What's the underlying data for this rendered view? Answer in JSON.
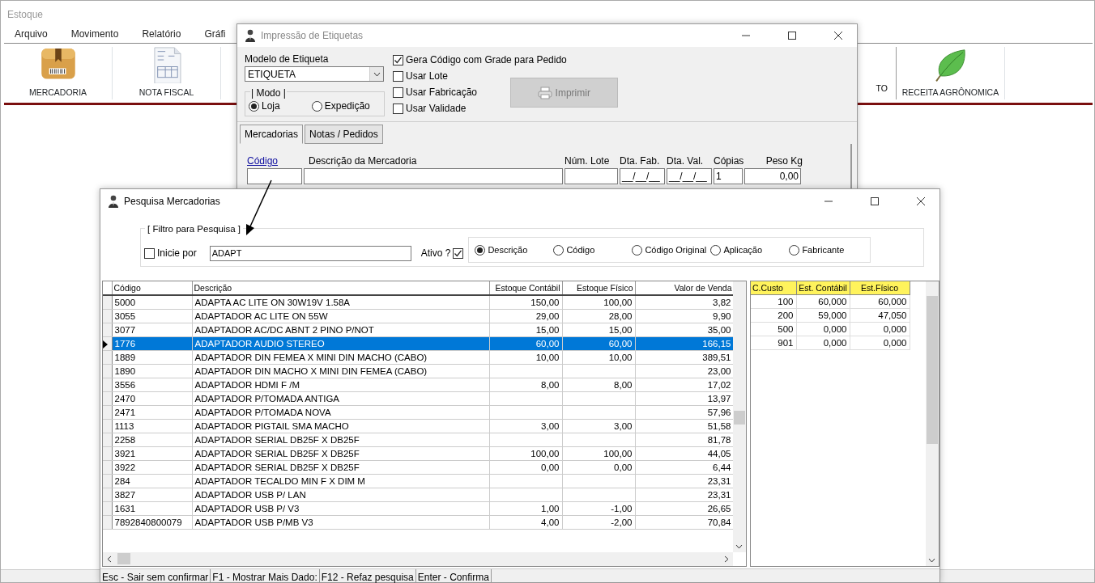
{
  "main_window": {
    "title": "Estoque",
    "menu": [
      {
        "label": "Arquivo"
      },
      {
        "label": "Movimento"
      },
      {
        "label": "Relatório"
      },
      {
        "label": "Gráfi"
      }
    ],
    "toolbar": [
      {
        "label": "MERCADORIA",
        "kind": "box"
      },
      {
        "label": "NOTA FISCAL",
        "kind": "document"
      },
      {
        "label": "TO",
        "kind": "partial"
      },
      {
        "label": "RECEITA AGRÔNOMICA",
        "kind": "leaf"
      }
    ]
  },
  "label_dialog": {
    "title": "Impressão de Etiquetas",
    "model_label": "Modelo de Etiqueta",
    "model_value": "ETIQUETA",
    "mode_label": "| Modo |",
    "modes": [
      {
        "label": "Loja",
        "selected": true
      },
      {
        "label": "Expedição",
        "selected": false
      }
    ],
    "options": [
      {
        "label": "Gera Código com Grade para Pedido",
        "checked": true
      },
      {
        "label": "Usar Lote",
        "checked": false
      },
      {
        "label": "Usar Fabricação",
        "checked": false
      },
      {
        "label": "Usar Validade",
        "checked": false
      }
    ],
    "print_button": {
      "label": "Imprimir",
      "disabled": true
    },
    "tabs": [
      {
        "label": "Mercadorias",
        "selected": true
      },
      {
        "label": "Notas / Pedidos",
        "selected": false
      }
    ],
    "fields": [
      {
        "label": "Código",
        "kind": "link"
      },
      {
        "label": "Descrição da Mercadoria",
        "kind": "label"
      },
      {
        "label": "Núm. Lote",
        "kind": "label"
      },
      {
        "label": "Dta. Fab.",
        "kind": "label",
        "value": "__/__/__"
      },
      {
        "label": "Dta. Val.",
        "kind": "label",
        "value": "__/__/__"
      },
      {
        "label": "Cópias",
        "kind": "label",
        "value": "1"
      },
      {
        "label": "Peso Kg",
        "kind": "label",
        "value": "0,00"
      }
    ]
  },
  "search_dialog": {
    "title": "Pesquisa Mercadorias",
    "filter_title": "[ Filtro para Pesquisa ]",
    "starts_with": {
      "label": "Inicie por",
      "checked": false
    },
    "search_value": "ADAPT",
    "active": {
      "label": "Ativo ?",
      "checked": true
    },
    "search_by": [
      {
        "label": "Descrição",
        "selected": true
      },
      {
        "label": "Código",
        "selected": false
      },
      {
        "label": "Código Original",
        "selected": false
      },
      {
        "label": "Aplicação",
        "selected": false
      },
      {
        "label": "Fabricante",
        "selected": false
      }
    ],
    "grid": {
      "columns": [
        "Código",
        "Descrição",
        "Estoque Contábil",
        "Estoque Físico",
        "Valor de Venda"
      ],
      "rows": [
        {
          "code": "5000",
          "description": "ADAPTA AC LITE ON 30W19V 1.58A",
          "stock_book": "150,00",
          "stock_physical": "100,00",
          "price": "3,82",
          "selected": false
        },
        {
          "code": "3055",
          "description": "ADAPTADOR AC LITE ON 55W",
          "stock_book": "29,00",
          "stock_physical": "28,00",
          "price": "9,90",
          "selected": false
        },
        {
          "code": "3077",
          "description": "ADAPTADOR AC/DC ABNT 2 PINO P/NOT",
          "stock_book": "15,00",
          "stock_physical": "15,00",
          "price": "35,00",
          "selected": false
        },
        {
          "code": "1776",
          "description": "ADAPTADOR AUDIO STEREO",
          "stock_book": "60,00",
          "stock_physical": "60,00",
          "price": "166,15",
          "selected": true
        },
        {
          "code": "1889",
          "description": "ADAPTADOR DIN FEMEA X MINI DIN MACHO (CABO)",
          "stock_book": "10,00",
          "stock_physical": "10,00",
          "price": "389,51",
          "selected": false
        },
        {
          "code": "1890",
          "description": "ADAPTADOR DIN MACHO X MINI DIN FEMEA (CABO)",
          "price": "23,00",
          "selected": false
        },
        {
          "code": "3556",
          "description": "ADAPTADOR HDMI F /M",
          "stock_book": "8,00",
          "stock_physical": "8,00",
          "price": "17,02",
          "selected": false
        },
        {
          "code": "2470",
          "description": "ADAPTADOR P/TOMADA ANTIGA",
          "price": "13,97",
          "selected": false
        },
        {
          "code": "2471",
          "description": "ADAPTADOR P/TOMADA NOVA",
          "price": "57,96",
          "selected": false
        },
        {
          "code": "1113",
          "description": "ADAPTADOR PIGTAIL SMA MACHO",
          "stock_book": "3,00",
          "stock_physical": "3,00",
          "price": "51,58",
          "selected": false
        },
        {
          "code": "2258",
          "description": "ADAPTADOR SERIAL DB25F X DB25F",
          "price": "81,78",
          "selected": false
        },
        {
          "code": "3921",
          "description": "ADAPTADOR SERIAL DB25F X DB25F",
          "stock_book": "100,00",
          "stock_physical": "100,00",
          "price": "44,05",
          "selected": false
        },
        {
          "code": "3922",
          "description": "ADAPTADOR SERIAL DB25F X DB25F",
          "stock_book": "0,00",
          "stock_physical": "0,00",
          "price": "6,44",
          "selected": false
        },
        {
          "code": "284",
          "description": "ADAPTADOR TECALDO MIN F X DIM M",
          "price": "23,31",
          "selected": false
        },
        {
          "code": "3827",
          "description": "ADAPTADOR USB P/ LAN",
          "price": "23,31",
          "selected": false
        },
        {
          "code": "1631",
          "description": "ADAPTADOR USB P/ V3",
          "stock_book": "1,00",
          "stock_physical": "-1,00",
          "price": "26,65",
          "selected": false
        },
        {
          "code": "7892840800079",
          "description": "ADAPTADOR USB P/MB V3",
          "stock_book": "4,00",
          "stock_physical": "-2,00",
          "price": "70,84",
          "selected": false
        }
      ]
    },
    "cost_grid": {
      "columns": [
        "C.Custo",
        "Est. Contábil",
        "Est.Físico"
      ],
      "rows": [
        [
          "100",
          "60,000",
          "60,000"
        ],
        [
          "200",
          "59,000",
          "47,050"
        ],
        [
          "500",
          "0,000",
          "0,000"
        ],
        [
          "901",
          "0,000",
          "0,000"
        ]
      ]
    },
    "status": [
      "Esc - Sair sem confirmar",
      "F1 - Mostrar Mais Dado:",
      "F12 - Refaz pesquisa",
      "Enter - Confirma"
    ]
  }
}
